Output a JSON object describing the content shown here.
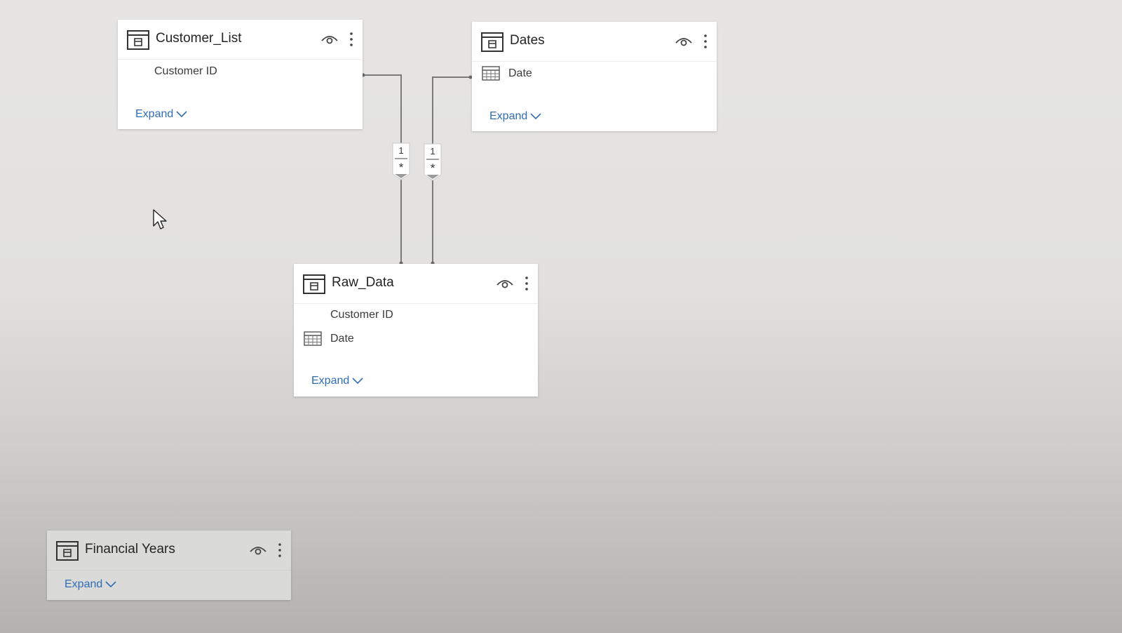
{
  "tables": {
    "customer_list": {
      "title": "Customer_List",
      "fields": [
        "Customer ID"
      ],
      "expand_label": "Expand"
    },
    "dates": {
      "title": "Dates",
      "fields": [
        "Date"
      ],
      "expand_label": "Expand"
    },
    "raw_data": {
      "title": "Raw_Data",
      "fields": [
        "Customer ID",
        "Date"
      ],
      "expand_label": "Expand"
    },
    "financial_years": {
      "title": "Financial Years",
      "expand_label": "Expand"
    }
  },
  "relationships": [
    {
      "from": "Customer_List",
      "to": "Raw_Data",
      "one_label": "1",
      "many_label": "*"
    },
    {
      "from": "Dates",
      "to": "Raw_Data",
      "one_label": "1",
      "many_label": "*"
    }
  ],
  "colors": {
    "link": "#2f6db5",
    "connector": "#7a7a7a",
    "card_bg": "#ffffff"
  },
  "icons": {
    "table": "table-icon",
    "visibility": "eye-icon",
    "menu": "more-options-icon",
    "date_field": "calendar-icon",
    "expand": "chevron-down-icon",
    "pointer": "cursor-icon"
  }
}
